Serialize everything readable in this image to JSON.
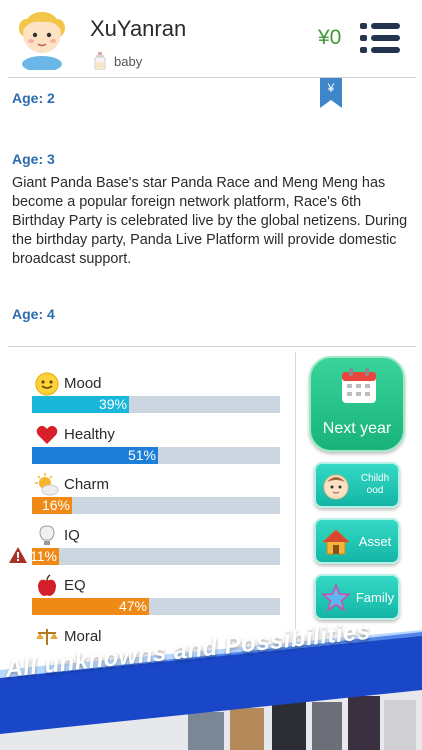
{
  "header": {
    "name": "XuYanran",
    "status": "baby",
    "money": "¥0",
    "bookmark_symbol": "¥"
  },
  "events": [
    {
      "age": "Age: 2",
      "text": ""
    },
    {
      "age": "Age: 3",
      "text": "Giant Panda Base's star Panda Race and Meng Meng has become a popular foreign network platform, Race's 6th Birthday Party is celebrated live by the global netizens. During the birthday party, Panda Live Platform will provide domestic broadcast support."
    },
    {
      "age": "Age: 4",
      "text": ""
    }
  ],
  "stats": [
    {
      "name": "Mood",
      "value": "39%",
      "fraction": 0.39,
      "color": "#19b7da",
      "icon": "smiley-icon"
    },
    {
      "name": "Healthy",
      "value": "51%",
      "fraction": 0.51,
      "color": "#1e7fd8",
      "icon": "heart-icon"
    },
    {
      "name": "Charm",
      "value": "16%",
      "fraction": 0.16,
      "color": "#f08a17",
      "icon": "sun-cloud-icon"
    },
    {
      "name": "IQ",
      "value": "11%",
      "fraction": 0.11,
      "color": "#f08a17",
      "icon": "lightbulb-icon"
    },
    {
      "name": "EQ",
      "value": "47%",
      "fraction": 0.47,
      "color": "#f08a17",
      "icon": "apple-icon"
    },
    {
      "name": "Moral",
      "value": "",
      "fraction": 0,
      "color": "#f08a17",
      "icon": "scales-icon"
    }
  ],
  "buttons": {
    "next_year": "Next year",
    "childhood": "Childh ood",
    "asset": "Asset",
    "family": "Family"
  },
  "banner": {
    "text": "All unknowns and Possibilities"
  },
  "colors": {
    "money": "#3f9a33",
    "age_heading": "#2b6cb0",
    "next_year_button": "#18b37b",
    "side_button": "#14b5a6",
    "banner_blue": "#1a47c8"
  }
}
